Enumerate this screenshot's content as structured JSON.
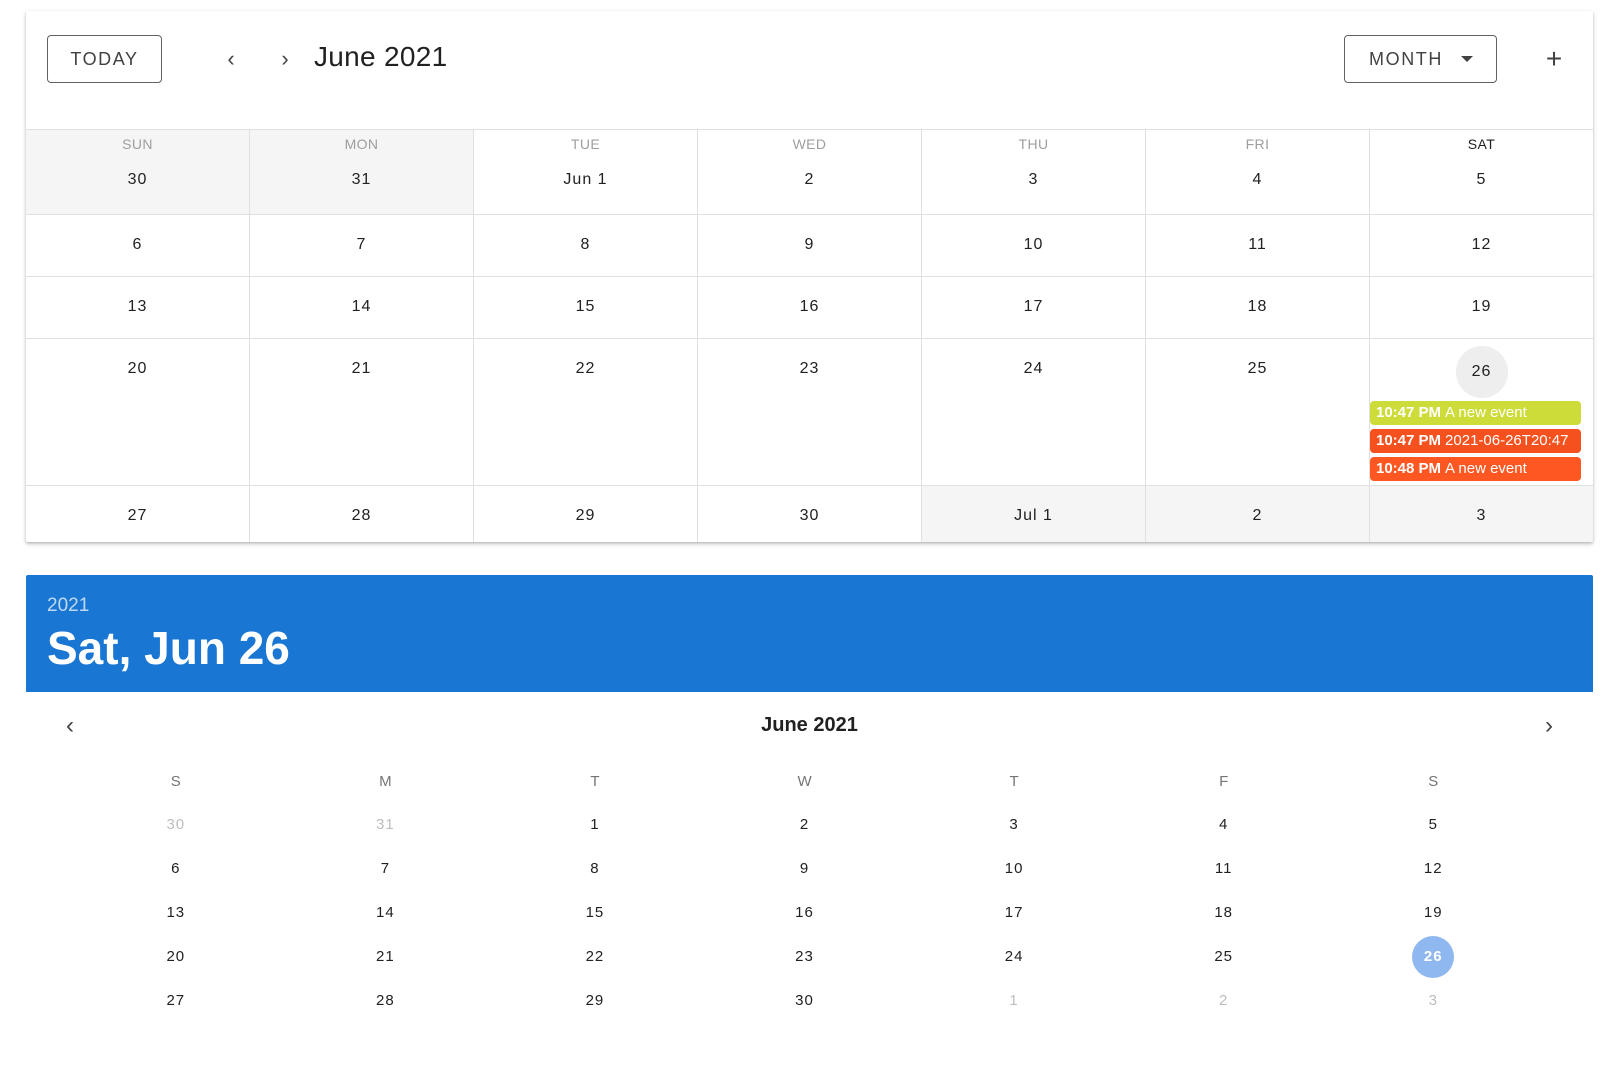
{
  "toolbar": {
    "today_label": "TODAY",
    "prev_icon": "chevron-left-icon",
    "next_icon": "chevron-right-icon",
    "title": "June 2021",
    "view_label": "MONTH",
    "add_icon": "plus-icon",
    "prev_glyph": "‹",
    "next_glyph": "›",
    "add_glyph": "+"
  },
  "calendar": {
    "weekdays": [
      "SUN",
      "MON",
      "TUE",
      "WED",
      "THU",
      "FRI",
      "SAT"
    ],
    "weeks": [
      [
        "30",
        "31",
        "Jun 1",
        "2",
        "3",
        "4",
        "5"
      ],
      [
        "6",
        "7",
        "8",
        "9",
        "10",
        "11",
        "12"
      ],
      [
        "13",
        "14",
        "15",
        "16",
        "17",
        "18",
        "19"
      ],
      [
        "20",
        "21",
        "22",
        "23",
        "24",
        "25",
        "26"
      ],
      [
        "27",
        "28",
        "29",
        "30",
        "Jul 1",
        "2",
        "3"
      ]
    ],
    "events": [
      {
        "time": "10:47 PM",
        "name": "A new event",
        "color": "#cddc39"
      },
      {
        "time": "10:47 PM",
        "name": "2021-06-26T20:47",
        "color": "#f4511e"
      },
      {
        "time": "10:48 PM",
        "name": "A new event",
        "color": "#ff5722"
      }
    ],
    "today": "26"
  },
  "picker": {
    "year": "2021",
    "date_label": "Sat, Jun 26",
    "header_color": "#1976d2",
    "month_title": "June 2021",
    "prev_glyph": "‹",
    "next_glyph": "›",
    "weekdays": [
      "S",
      "M",
      "T",
      "W",
      "T",
      "F",
      "S"
    ],
    "rows": [
      [
        "30",
        "31",
        "1",
        "2",
        "3",
        "4",
        "5"
      ],
      [
        "6",
        "7",
        "8",
        "9",
        "10",
        "11",
        "12"
      ],
      [
        "13",
        "14",
        "15",
        "16",
        "17",
        "18",
        "19"
      ],
      [
        "20",
        "21",
        "22",
        "23",
        "24",
        "25",
        "26"
      ],
      [
        "27",
        "28",
        "29",
        "30",
        "1",
        "2",
        "3"
      ]
    ],
    "selected": "26"
  }
}
